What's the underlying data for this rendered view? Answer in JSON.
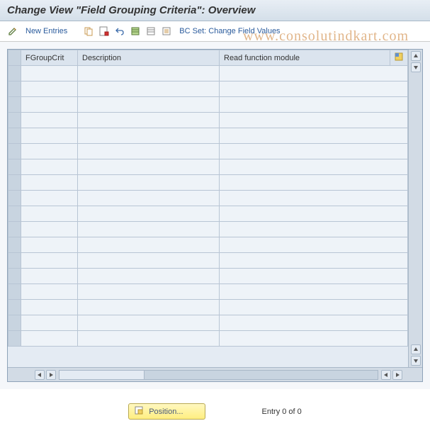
{
  "header": {
    "title": "Change View \"Field Grouping Criteria\": Overview"
  },
  "toolbar": {
    "new_entries_label": "New Entries",
    "bc_set_label": "BC Set: Change Field Values"
  },
  "table": {
    "columns": {
      "fgroupcrit": "FGroupCrit",
      "description": "Description",
      "read_function": "Read function module"
    },
    "rows": [
      {
        "fgroupcrit": "",
        "description": "",
        "read_function": ""
      },
      {
        "fgroupcrit": "",
        "description": "",
        "read_function": ""
      },
      {
        "fgroupcrit": "",
        "description": "",
        "read_function": ""
      },
      {
        "fgroupcrit": "",
        "description": "",
        "read_function": ""
      },
      {
        "fgroupcrit": "",
        "description": "",
        "read_function": ""
      },
      {
        "fgroupcrit": "",
        "description": "",
        "read_function": ""
      },
      {
        "fgroupcrit": "",
        "description": "",
        "read_function": ""
      },
      {
        "fgroupcrit": "",
        "description": "",
        "read_function": ""
      },
      {
        "fgroupcrit": "",
        "description": "",
        "read_function": ""
      },
      {
        "fgroupcrit": "",
        "description": "",
        "read_function": ""
      },
      {
        "fgroupcrit": "",
        "description": "",
        "read_function": ""
      },
      {
        "fgroupcrit": "",
        "description": "",
        "read_function": ""
      },
      {
        "fgroupcrit": "",
        "description": "",
        "read_function": ""
      },
      {
        "fgroupcrit": "",
        "description": "",
        "read_function": ""
      },
      {
        "fgroupcrit": "",
        "description": "",
        "read_function": ""
      },
      {
        "fgroupcrit": "",
        "description": "",
        "read_function": ""
      },
      {
        "fgroupcrit": "",
        "description": "",
        "read_function": ""
      },
      {
        "fgroupcrit": "",
        "description": "",
        "read_function": ""
      }
    ]
  },
  "footer": {
    "position_label": "Position...",
    "status_text": "Entry 0 of 0"
  },
  "watermark": "www.consolutindkart.com",
  "icons": {
    "edit": "edit-icon",
    "copy": "copy-icon",
    "save_with_marker": "save-marker-icon",
    "undo": "undo-icon",
    "select_all": "select-all-icon",
    "deselect_all": "deselect-all-icon",
    "list": "list-icon",
    "config": "table-config-icon",
    "position": "position-icon"
  },
  "colors": {
    "header_bg": "#dbe4ee",
    "row_bg": "#eef3f8",
    "border": "#b8c5d4",
    "button_bg": "#ffee80"
  }
}
